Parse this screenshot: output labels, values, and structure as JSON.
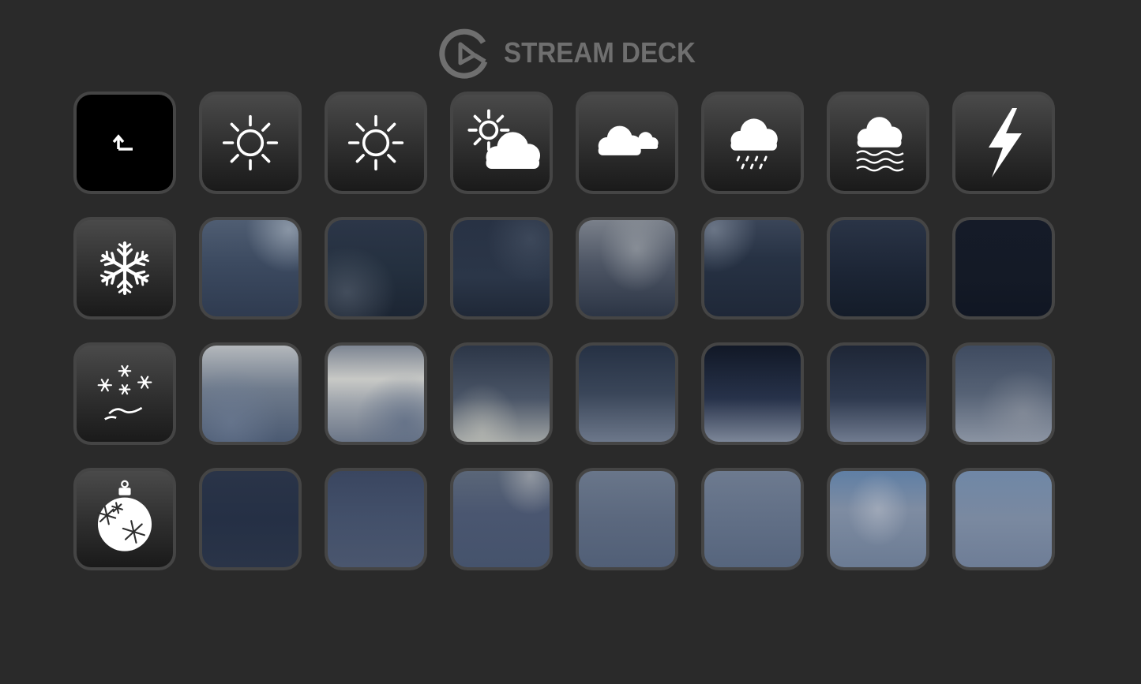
{
  "header": {
    "brand_name": "STREAM DECK",
    "logo_icon": "elgato-logo-icon"
  },
  "keys": [
    {
      "kind": "icon",
      "icon": "back-arrow-icon",
      "name": "key-back"
    },
    {
      "kind": "icon",
      "icon": "sun-icon",
      "name": "key-sunny"
    },
    {
      "kind": "icon",
      "icon": "sun-icon",
      "name": "key-clear"
    },
    {
      "kind": "icon",
      "icon": "partly-cloudy-icon",
      "name": "key-partly-cloudy"
    },
    {
      "kind": "icon",
      "icon": "cloudy-icon",
      "name": "key-cloudy"
    },
    {
      "kind": "icon",
      "icon": "rain-icon",
      "name": "key-rain"
    },
    {
      "kind": "icon",
      "icon": "fog-wind-icon",
      "name": "key-fog"
    },
    {
      "kind": "icon",
      "icon": "lightning-icon",
      "name": "key-storm"
    },
    {
      "kind": "icon",
      "icon": "snowflake-icon",
      "name": "key-snow"
    },
    {
      "kind": "sky",
      "name": "key-sky"
    },
    {
      "kind": "sky",
      "name": "key-sky"
    },
    {
      "kind": "sky",
      "name": "key-sky"
    },
    {
      "kind": "sky",
      "name": "key-sky"
    },
    {
      "kind": "sky",
      "name": "key-sky"
    },
    {
      "kind": "sky",
      "name": "key-sky"
    },
    {
      "kind": "sky",
      "name": "key-sky"
    },
    {
      "kind": "icon",
      "icon": "snow-wind-icon",
      "name": "key-blizzard"
    },
    {
      "kind": "sky",
      "name": "key-sky"
    },
    {
      "kind": "sky",
      "name": "key-sky"
    },
    {
      "kind": "sky",
      "name": "key-sky"
    },
    {
      "kind": "sky",
      "name": "key-sky"
    },
    {
      "kind": "sky",
      "name": "key-sky"
    },
    {
      "kind": "sky",
      "name": "key-sky"
    },
    {
      "kind": "sky",
      "name": "key-sky"
    },
    {
      "kind": "icon",
      "icon": "christmas-ornament-icon",
      "name": "key-holiday"
    },
    {
      "kind": "sky",
      "name": "key-sky"
    },
    {
      "kind": "sky",
      "name": "key-sky"
    },
    {
      "kind": "sky",
      "name": "key-sky"
    },
    {
      "kind": "sky",
      "name": "key-sky"
    },
    {
      "kind": "sky",
      "name": "key-sky"
    },
    {
      "kind": "sky",
      "name": "key-sky"
    },
    {
      "kind": "sky",
      "name": "key-sky"
    }
  ],
  "colors": {
    "background": "#2a2a2a",
    "key_border": "#454545",
    "brand_text": "#6f6f6f"
  }
}
